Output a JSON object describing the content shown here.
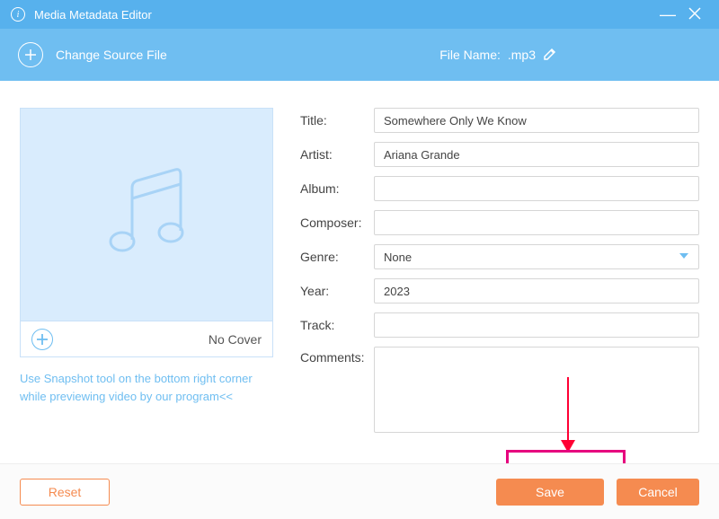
{
  "window": {
    "title": "Media Metadata Editor"
  },
  "toolbar": {
    "change_source_label": "Change Source File",
    "filename_label": "File Name:",
    "filename_value": ".mp3"
  },
  "cover": {
    "no_cover_label": "No Cover",
    "hint_text": "Use Snapshot tool on the bottom right corner while previewing video by our program<<"
  },
  "form": {
    "title": {
      "label": "Title:",
      "value": "Somewhere Only We Know"
    },
    "artist": {
      "label": "Artist:",
      "value": "Ariana Grande"
    },
    "album": {
      "label": "Album:",
      "value": ""
    },
    "composer": {
      "label": "Composer:",
      "value": ""
    },
    "genre": {
      "label": "Genre:",
      "selected": "None"
    },
    "year": {
      "label": "Year:",
      "value": "2023"
    },
    "track": {
      "label": "Track:",
      "value": ""
    },
    "comments": {
      "label": "Comments:",
      "value": ""
    }
  },
  "footer": {
    "reset_label": "Reset",
    "save_label": "Save",
    "cancel_label": "Cancel"
  }
}
